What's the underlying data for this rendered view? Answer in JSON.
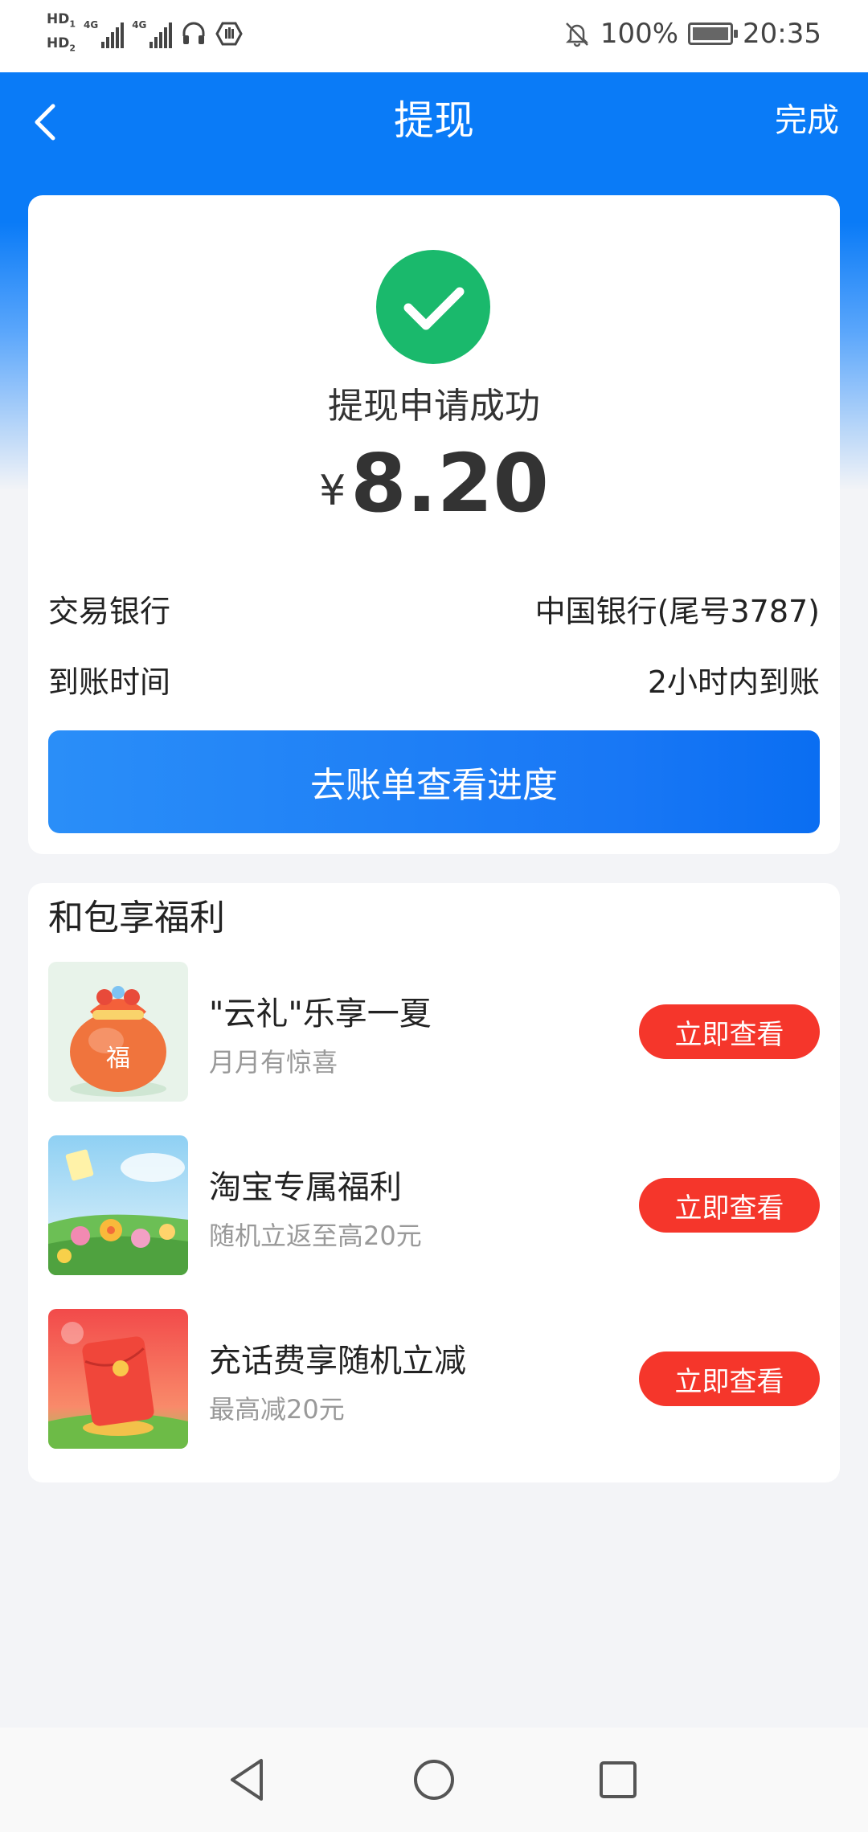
{
  "status_bar": {
    "sim1": "HD",
    "sim1_index": "1",
    "sim2": "HD",
    "sim2_index": "2",
    "network1": "4G",
    "network2": "4G",
    "battery": "100%",
    "battery_level": 1.0,
    "time": "20:35",
    "icons": [
      "headset-icon",
      "shield-icon",
      "bell-off-icon",
      "battery-icon"
    ]
  },
  "nav": {
    "back_icon": "chevron-left-icon",
    "title": "提现",
    "done": "完成"
  },
  "result": {
    "success_icon": "check-circle-icon",
    "status_text": "提现申请成功",
    "currency": "¥",
    "amount": "8.20"
  },
  "info": {
    "bank_label": "交易银行",
    "bank_value": "中国银行(尾号3787)",
    "time_label": "到账时间",
    "time_value": "2小时内到账"
  },
  "progress_button": "去账单查看进度",
  "benefits": {
    "title": "和包享福利",
    "items": [
      {
        "title": "\"云礼\"乐享一夏",
        "subtitle": "月月有惊喜",
        "button": "立即查看",
        "image": "lucky-bag-image"
      },
      {
        "title": "淘宝专属福利",
        "subtitle": "随机立返至高20元",
        "button": "立即查看",
        "image": "flower-field-image"
      },
      {
        "title": "充话费享随机立减",
        "subtitle": "最高减20元",
        "button": "立即查看",
        "image": "red-envelope-image"
      }
    ]
  },
  "system_nav": [
    "back-triangle-icon",
    "home-circle-icon",
    "recent-square-icon"
  ],
  "colors": {
    "primary_blue": "#0a7bf7",
    "success_green": "#1ab96c",
    "button_red": "#f5362b",
    "background": "#f3f4f7"
  }
}
